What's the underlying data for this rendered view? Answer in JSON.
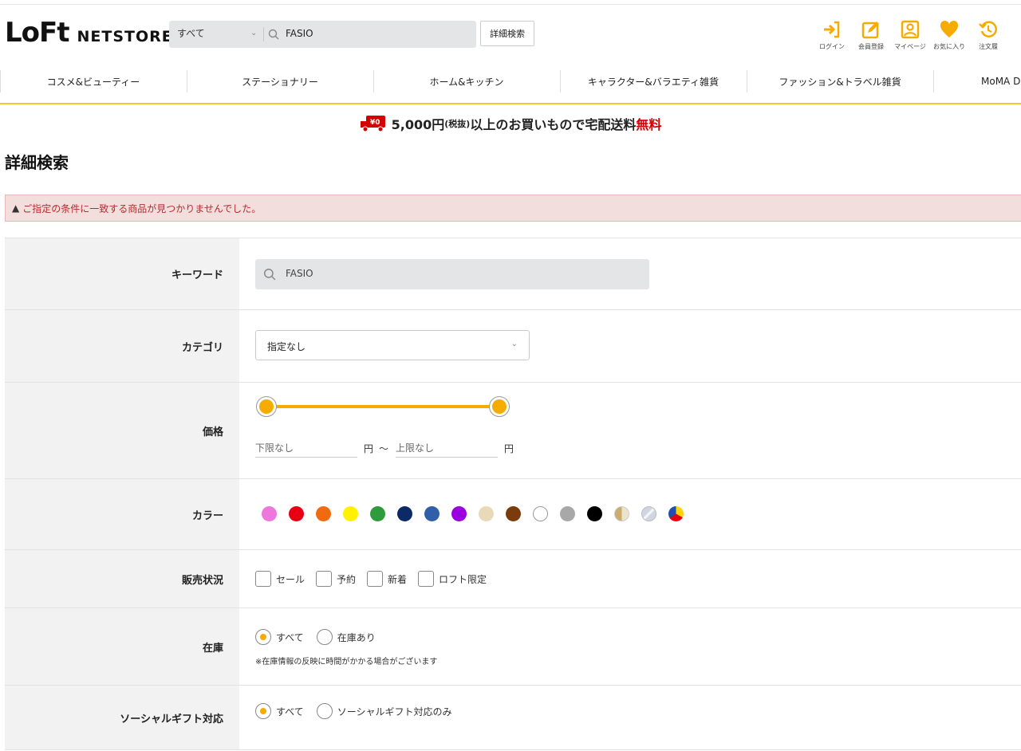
{
  "header": {
    "logo_mark": "LoFt",
    "logo_text": "NETSTORE",
    "search_scope": "すべて",
    "search_value": "FASIO",
    "advanced_search_label": "詳細検索",
    "icons": [
      {
        "name": "login-icon",
        "label": "ログイン"
      },
      {
        "name": "register-icon",
        "label": "会員登録"
      },
      {
        "name": "mypage-icon",
        "label": "マイページ"
      },
      {
        "name": "favorite-icon",
        "label": "お気に入り"
      },
      {
        "name": "order-history-icon",
        "label": "注文履"
      }
    ],
    "accent_color": "#f5ab00"
  },
  "nav": {
    "items": [
      "コスメ&ビューティー",
      "ステーショナリー",
      "ホーム&キッチン",
      "キャラクター&バラエティ雑貨",
      "ファッション&トラベル雑貨",
      "MoMA D"
    ]
  },
  "banner": {
    "amount": "5,000円",
    "tax_note": "(税抜)",
    "text": "以上のお買いもので宅配送料",
    "free": "無料"
  },
  "page": {
    "title": "詳細検索",
    "alert_text": "ご指定の条件に一致する商品が見つかりませんでした。"
  },
  "form": {
    "keyword": {
      "label": "キーワード",
      "value": "FASIO"
    },
    "category": {
      "label": "カテゴリ",
      "selected": "指定なし"
    },
    "price": {
      "label": "価格",
      "min_placeholder": "下限なし",
      "max_placeholder": "上限なし",
      "unit": "円",
      "tilde": "～",
      "slider_min_fraction": 0,
      "slider_max_fraction": 1
    },
    "color": {
      "label": "カラー",
      "swatches": [
        {
          "name": "pink",
          "hex": "#ee77dd"
        },
        {
          "name": "red",
          "hex": "#e60012"
        },
        {
          "name": "orange",
          "hex": "#f06a0f"
        },
        {
          "name": "yellow",
          "hex": "#fff100"
        },
        {
          "name": "green",
          "hex": "#2e9b3c"
        },
        {
          "name": "navy",
          "hex": "#0b2a66"
        },
        {
          "name": "blue",
          "hex": "#2f5fa8"
        },
        {
          "name": "purple",
          "hex": "#9b00e0"
        },
        {
          "name": "beige",
          "hex": "#e8d9b8"
        },
        {
          "name": "brown",
          "hex": "#7a3c0f"
        },
        {
          "name": "white",
          "hex": "#ffffff"
        },
        {
          "name": "gray",
          "hex": "#a8a8a8"
        },
        {
          "name": "black",
          "hex": "#000000"
        },
        {
          "name": "gold",
          "hex": "#c8ad6e"
        },
        {
          "name": "silver",
          "hex": "#cfd6e2"
        },
        {
          "name": "multi",
          "hex": "#e60012"
        }
      ]
    },
    "sales_status": {
      "label": "販売状況",
      "options": [
        "セール",
        "予約",
        "新着",
        "ロフト限定"
      ]
    },
    "stock": {
      "label": "在庫",
      "options": [
        "すべて",
        "在庫あり"
      ],
      "selected": "すべて",
      "note": "※在庫情報の反映に時間がかかる場合がございます"
    },
    "social_gift": {
      "label": "ソーシャルギフト対応",
      "options": [
        "すべて",
        "ソーシャルギフト対応のみ"
      ],
      "selected": "すべて"
    }
  }
}
